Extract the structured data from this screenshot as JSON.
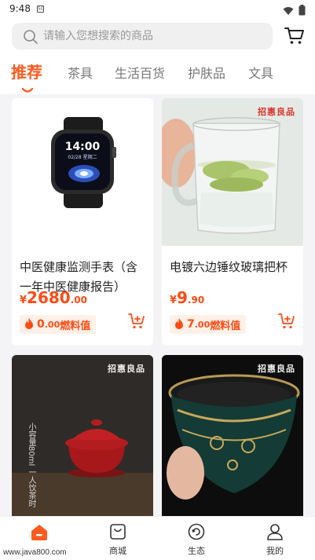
{
  "status_bar": {
    "time": "9:48",
    "sim_label": "5G",
    "wifi_icon": "wifi-icon",
    "battery_icon": "battery-icon"
  },
  "search": {
    "placeholder": "请输入您想搜索的商品",
    "icon": "search-icon"
  },
  "header": {
    "cart_icon": "cart-icon"
  },
  "tabs": [
    {
      "label": "推荐",
      "active": true
    },
    {
      "label": "茶具",
      "active": false
    },
    {
      "label": "生活百货",
      "active": false
    },
    {
      "label": "护肤品",
      "active": false
    },
    {
      "label": "文具",
      "active": false
    }
  ],
  "products": [
    {
      "title": "中医健康监测手表（含一年中医健康报告）",
      "currency": "¥",
      "price_int": "2680",
      "price_dec": ".00",
      "fuel_int": "0",
      "fuel_dec": ".00",
      "fuel_unit": "燃料值",
      "watch_time": "14:00",
      "watch_date": "02/28 星期二"
    },
    {
      "title": "电镀六边锤纹玻璃把杯",
      "currency": "¥",
      "price_int": "9",
      "price_dec": ".90",
      "fuel_int": "7",
      "fuel_dec": ".00",
      "fuel_unit": "燃料值",
      "brand": "招惠良品"
    },
    {
      "brand": "招惠良品",
      "image_text": "小容量80ml 一人饮茶时"
    },
    {
      "brand": "招惠良品"
    }
  ],
  "bottom_nav": [
    {
      "label": "",
      "icon": "home-icon",
      "active": true
    },
    {
      "label": "商城",
      "icon": "shop-icon",
      "active": false
    },
    {
      "label": "生态",
      "icon": "ecology-icon",
      "active": false
    },
    {
      "label": "我的",
      "icon": "profile-icon",
      "active": false
    }
  ],
  "watermark": "www.java800.com",
  "colors": {
    "accent": "#ff5a1f",
    "price": "#ff4a12",
    "background": "#f4f4f6"
  }
}
